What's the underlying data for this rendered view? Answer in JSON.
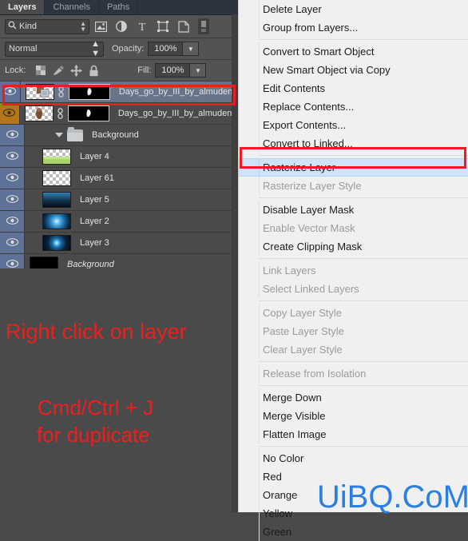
{
  "panel": {
    "tabs": [
      {
        "label": "Layers",
        "active": true
      },
      {
        "label": "Channels",
        "active": false
      },
      {
        "label": "Paths",
        "active": false
      }
    ],
    "filter": {
      "kind_label": "Kind",
      "search_icon": "magnifier-icon",
      "icons": [
        "pixel-layer-filter-icon",
        "adjustment-layer-filter-icon",
        "type-layer-filter-icon",
        "shape-layer-filter-icon",
        "smart-object-filter-icon",
        "filter-toggle-switch"
      ]
    },
    "blend": {
      "mode": "Normal",
      "opacity_label": "Opacity:",
      "opacity_value": "100%"
    },
    "lock": {
      "label": "Lock:",
      "icons": [
        "lock-transparent-pixels-icon",
        "lock-image-pixels-icon",
        "lock-position-icon",
        "lock-all-icon"
      ],
      "fill_label": "Fill:",
      "fill_value": "100%"
    },
    "layers": [
      {
        "name": "Days_go_by_III_by_almudena_stock",
        "type": "smart-object-mask",
        "selected": true,
        "eye": "visible",
        "eye_style": "selected"
      },
      {
        "name": "Days_go_by_III_by_almudena_stock c",
        "type": "smart-object-mask",
        "selected": false,
        "eye": "visible",
        "eye_style": "amber"
      },
      {
        "name": "Background",
        "type": "group",
        "selected": false,
        "eye": "visible",
        "eye_style": "selected"
      },
      {
        "name": "Layer 4",
        "type": "raster",
        "thumb": "grass",
        "selected": false,
        "eye": "visible",
        "eye_style": "selected"
      },
      {
        "name": "Layer 61",
        "type": "raster",
        "thumb": "empty",
        "selected": false,
        "eye": "visible",
        "eye_style": "selected"
      },
      {
        "name": "Layer 5",
        "type": "raster",
        "thumb": "darkblue",
        "selected": false,
        "eye": "visible",
        "eye_style": "selected"
      },
      {
        "name": "Layer 2",
        "type": "raster",
        "thumb": "glow",
        "selected": false,
        "eye": "visible",
        "eye_style": "selected"
      },
      {
        "name": "Layer 3",
        "type": "raster",
        "thumb": "glow-small",
        "selected": false,
        "eye": "visible",
        "eye_style": "selected"
      },
      {
        "name": "Background",
        "type": "background",
        "thumb": "black",
        "italic": true,
        "selected": false,
        "eye": "visible",
        "eye_style": "selected"
      }
    ],
    "annotations": [
      {
        "id": "note1",
        "text": "Right click on layer"
      },
      {
        "id": "note2",
        "text": "Cmd/Ctrl + J"
      },
      {
        "id": "note3",
        "text": "for duplicate"
      }
    ]
  },
  "context_menu": {
    "items": [
      {
        "label": "Delete Layer",
        "disabled": false,
        "highlighted": false
      },
      {
        "label": "Group from Layers...",
        "disabled": false,
        "highlighted": false
      },
      {
        "separator": true
      },
      {
        "label": "Convert to Smart Object",
        "disabled": false,
        "highlighted": false
      },
      {
        "label": "New Smart Object via Copy",
        "disabled": false,
        "highlighted": false
      },
      {
        "label": "Edit Contents",
        "disabled": false,
        "highlighted": false
      },
      {
        "label": "Replace Contents...",
        "disabled": false,
        "highlighted": false
      },
      {
        "label": "Export Contents...",
        "disabled": false,
        "highlighted": false
      },
      {
        "label": "Convert to Linked...",
        "disabled": false,
        "highlighted": false
      },
      {
        "separator": true
      },
      {
        "label": "Rasterize Layer",
        "disabled": false,
        "highlighted": true
      },
      {
        "label": "Rasterize Layer Style",
        "disabled": true,
        "highlighted": false
      },
      {
        "separator": true
      },
      {
        "label": "Disable Layer Mask",
        "disabled": false,
        "highlighted": false
      },
      {
        "label": "Enable Vector Mask",
        "disabled": true,
        "highlighted": false
      },
      {
        "label": "Create Clipping Mask",
        "disabled": false,
        "highlighted": false
      },
      {
        "separator": true
      },
      {
        "label": "Link Layers",
        "disabled": true,
        "highlighted": false
      },
      {
        "label": "Select Linked Layers",
        "disabled": true,
        "highlighted": false
      },
      {
        "separator": true
      },
      {
        "label": "Copy Layer Style",
        "disabled": true,
        "highlighted": false
      },
      {
        "label": "Paste Layer Style",
        "disabled": true,
        "highlighted": false
      },
      {
        "label": "Clear Layer Style",
        "disabled": true,
        "highlighted": false
      },
      {
        "separator": true
      },
      {
        "label": "Release from Isolation",
        "disabled": true,
        "highlighted": false
      },
      {
        "separator": true
      },
      {
        "label": "Merge Down",
        "disabled": false,
        "highlighted": false
      },
      {
        "label": "Merge Visible",
        "disabled": false,
        "highlighted": false
      },
      {
        "label": "Flatten Image",
        "disabled": false,
        "highlighted": false
      },
      {
        "separator": true
      },
      {
        "label": "No Color",
        "disabled": false,
        "highlighted": false
      },
      {
        "label": "Red",
        "disabled": false,
        "highlighted": false
      },
      {
        "label": "Orange",
        "disabled": false,
        "highlighted": false
      },
      {
        "label": "Yellow",
        "disabled": false,
        "highlighted": false
      },
      {
        "label": "Green",
        "disabled": false,
        "highlighted": false
      }
    ]
  },
  "watermark": {
    "text": "UiBQ.CoM",
    "color": "#2b7fe0"
  },
  "highlight_color": "#ed1c24",
  "annotation_color": "#f01d1d"
}
